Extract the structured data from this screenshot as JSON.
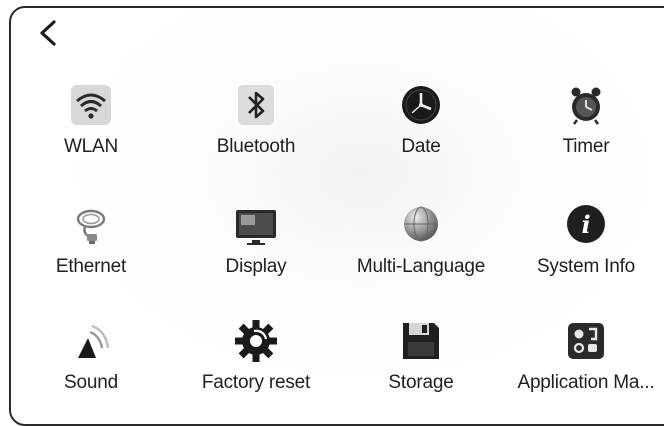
{
  "header": {
    "back_icon": "chevron-left-icon"
  },
  "settings": {
    "items": [
      {
        "label": "WLAN",
        "icon": "wifi-icon"
      },
      {
        "label": "Bluetooth",
        "icon": "bluetooth-icon"
      },
      {
        "label": "Date",
        "icon": "clock-icon"
      },
      {
        "label": "Timer",
        "icon": "alarm-clock-icon"
      },
      {
        "label": "Ethernet",
        "icon": "ethernet-cable-icon"
      },
      {
        "label": "Display",
        "icon": "monitor-icon"
      },
      {
        "label": "Multi-Language",
        "icon": "globe-icon"
      },
      {
        "label": "System Info",
        "icon": "info-icon"
      },
      {
        "label": "Sound",
        "icon": "speaker-icon"
      },
      {
        "label": "Factory reset",
        "icon": "gear-icon"
      },
      {
        "label": "Storage",
        "icon": "floppy-disk-icon"
      },
      {
        "label": "Application Ma...",
        "icon": "app-manager-icon"
      }
    ]
  }
}
